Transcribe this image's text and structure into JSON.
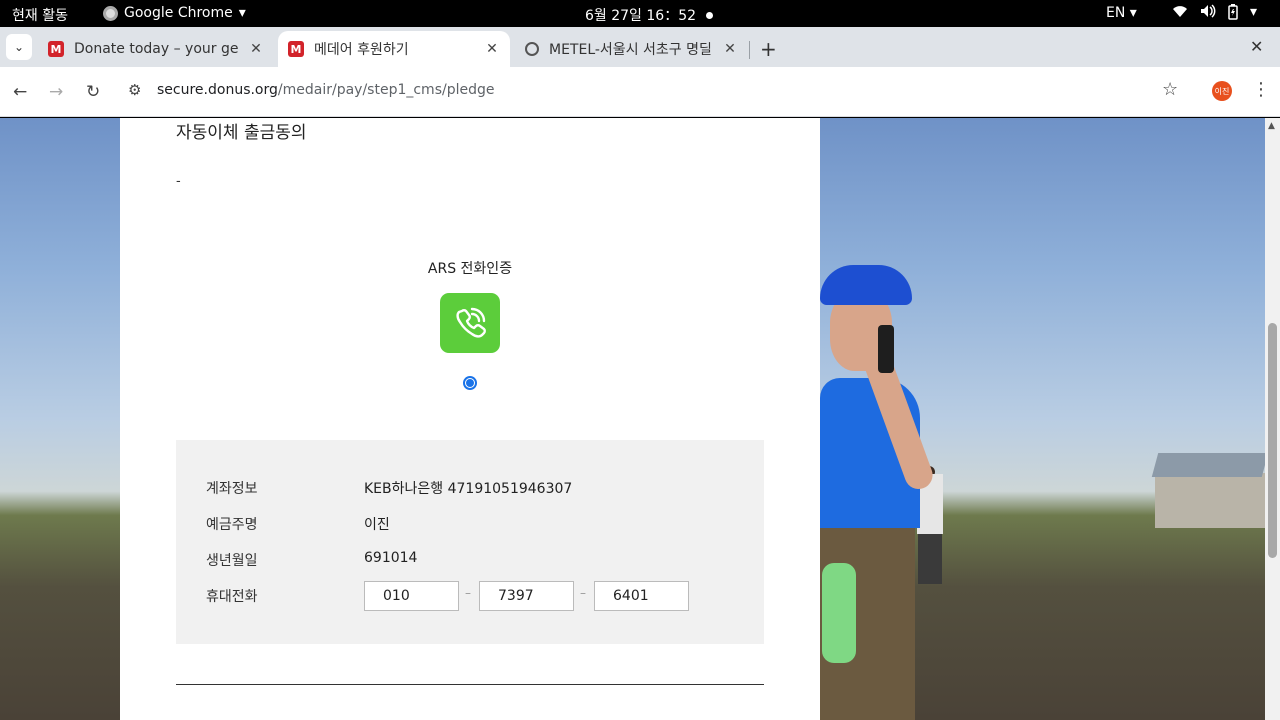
{
  "topbar": {
    "activities": "현재 활동",
    "app_name": "Google Chrome",
    "datetime": "6월 27일 16：52",
    "language": "EN"
  },
  "tabs": [
    {
      "title": "Donate today – your ge",
      "favicon": "medair-m-icon",
      "favicon_text": "M",
      "active": false
    },
    {
      "title": "메데어 후원하기",
      "favicon": "medair-m-icon",
      "favicon_text": "M",
      "active": true
    },
    {
      "title": "METEL-서울시 서초구 명딜",
      "favicon": "globe-icon",
      "favicon_text": "",
      "active": false
    }
  ],
  "toolbar": {
    "url_domain": "secure.donus.org",
    "url_path": "/medair/pay/step1_cms/pledge",
    "profile_label": "이진"
  },
  "page": {
    "heading": "자동이체 출금동의",
    "dash": "-",
    "ars_label": "ARS 전화인증",
    "rule_row_labels": [
      "계좌정보",
      "예금주명",
      "생년월일",
      "휴대전화"
    ],
    "account_info": "KEB하나은행 47191051946307",
    "holder_name": "이진",
    "birthdate": "691014",
    "phone": [
      "010",
      "7397",
      "6401"
    ],
    "phone_separator": "–"
  },
  "colors": {
    "ars_green": "#5ccd3b",
    "radio_blue": "#1a73e8",
    "info_bg": "#f1f1f1",
    "medair_red": "#d2232a"
  }
}
